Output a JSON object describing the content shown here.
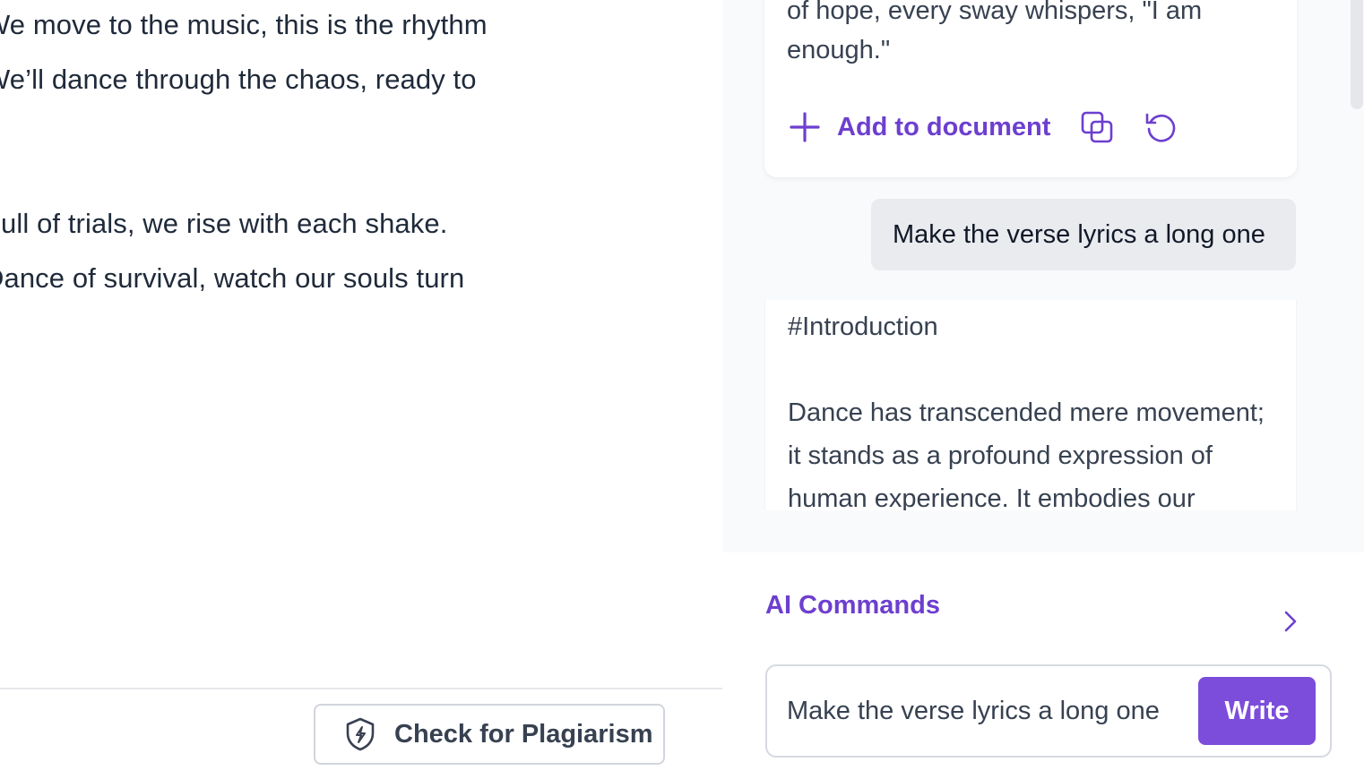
{
  "editor": {
    "lines": [
      "We move to the music, this is the rhythm",
      "We’ll dance through the chaos, ready to",
      "Full of trials, we rise with each shake.",
      "Dance of survival, watch our souls turn"
    ],
    "plagiarism_button": "Check for Plagiarism"
  },
  "assistant": {
    "previous_response": {
      "lines": [
        "of hope, every sway whispers, \"I am",
        "enough.\""
      ],
      "add_to_document": "Add to document",
      "copy_icon": "copy-icon",
      "regenerate_icon": "refresh-icon"
    },
    "user_message": "Make the verse lyrics a long one",
    "current_response": {
      "lines": [
        "#Introduction",
        "",
        "Dance has transcended mere movement;",
        "it stands as a profound expression of",
        "human experience. It embodies our"
      ]
    },
    "commands": {
      "title": "AI Commands",
      "input_value": "Make the verse lyrics a long one",
      "write_button": "Write"
    }
  },
  "colors": {
    "accent": "#6d3fcf",
    "write_button": "#7c4ddb",
    "panel_bg": "#f8fafc",
    "bubble_bg": "#e9ebef"
  }
}
